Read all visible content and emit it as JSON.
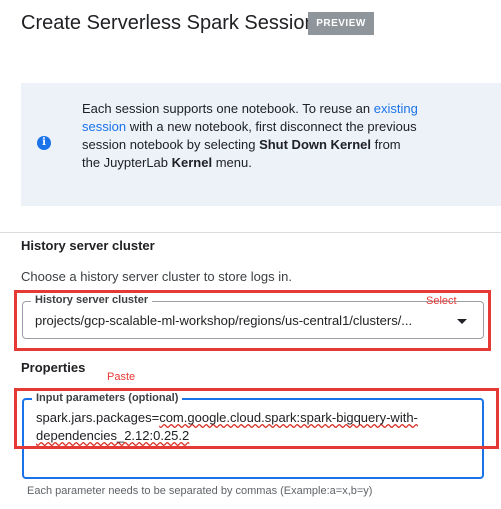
{
  "header": {
    "title": "Create Serverless Spark Session",
    "badge": "PREVIEW"
  },
  "info_banner": {
    "icon": "info-icon",
    "text_1": "Each session supports one notebook. To reuse an",
    "link": "existing session",
    "text_2": " with a new notebook, first disconnect the previous session notebook by selecting ",
    "bold_1": "Shut Down Kernel",
    "text_3": " from the JuypterLab ",
    "bold_2": "Kernel",
    "text_4": " menu."
  },
  "history_section": {
    "heading": "History server cluster",
    "description": "Choose a history server cluster to store logs in.",
    "field_label": "History server cluster",
    "selected_value": "projects/gcp-scalable-ml-workshop/regions/us-central1/clusters/..."
  },
  "properties_section": {
    "heading": "Properties",
    "field_label": "Input parameters (optional)",
    "value_part_1": "spark.jars.packages=",
    "value_part_2": "com.google.cloud.spark:spark-bigquery-with-dependencies_2.12:0.25.2",
    "helper": "Each parameter needs to be separated by commas (Example:a=x,b=y)"
  },
  "annotations": {
    "select": "Select",
    "paste": "Paste",
    "color": "#e53935"
  }
}
